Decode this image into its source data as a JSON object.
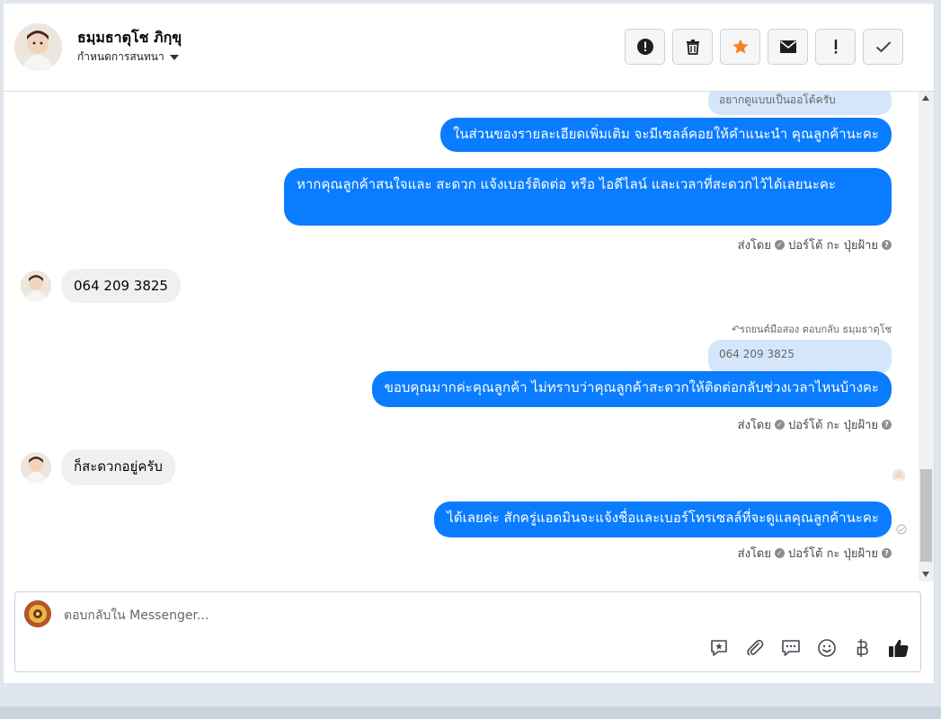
{
  "header": {
    "contact_name": "ธมฺมธาตุโช ภิกฺขุ",
    "assign_label": "กำหนดการสนทนา",
    "actions": [
      "alert-circle-icon",
      "trash-icon",
      "star-icon",
      "mail-icon",
      "exclamation-icon",
      "check-icon"
    ]
  },
  "messages": {
    "quote1": "อยากดูแบบเป็นออโต้ครับ",
    "out1": "ในส่วนของรายละเอียดเพิ่มเติม จะมีเซลล์คอยให้คำแนะนำ คุณลูกค้านะคะ",
    "out2": "หากคุณลูกค้าสนใจและ สะดวก แจ้งเบอร์ติดต่อ หรือ ไอดีไลน์ และเวลาที่สะดวกไว้ได้เลยนะคะ",
    "in1": "064 209 3825",
    "reply_meta": "รถยนต์มือสอง ตอบกลับ ธมฺมธาตุโช",
    "quote2": "064 209 3825",
    "out3": "ขอบคุณมากค่ะคุณลูกค้า ไม่ทราบว่าคุณลูกค้าสะดวกให้ติดต่อกลับช่วงเวลาไหนบ้างคะ",
    "in2": "ก็สะดวกอยู่ครับ",
    "out4": "ได้เลยค่ะ สักครู่แอดมินจะแจ้งชื่อและเบอร์โทรเซลล์ที่จะดูแลคุณลูกค้านะคะ",
    "sent_by_prefix": "ส่งโดย",
    "sent_by_name": "ปอร์โต้ กะ ปุ่ยฝ้าย"
  },
  "composer": {
    "placeholder": "ตอบกลับใน Messenger...",
    "tools": [
      "saved-reply-icon",
      "attachment-icon",
      "chat-bubbles-icon",
      "emoji-icon",
      "baht-icon",
      "thumbs-up-icon"
    ]
  }
}
